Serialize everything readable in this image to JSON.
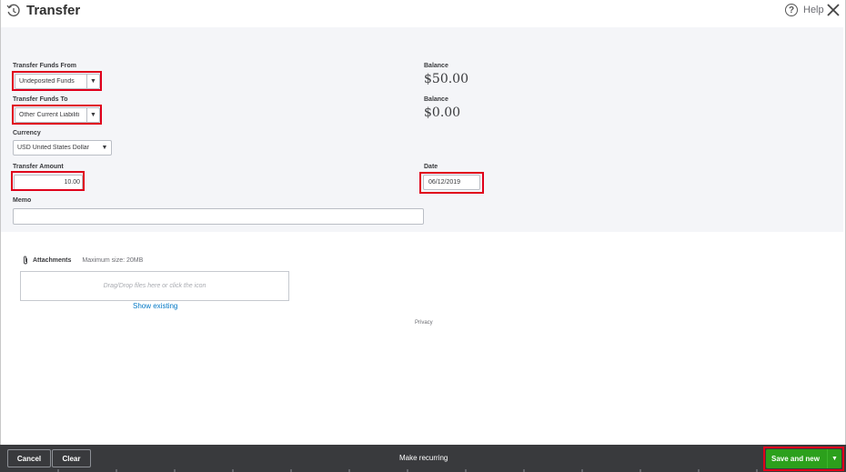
{
  "header": {
    "title": "Transfer",
    "help_label": "Help",
    "icons": {
      "title": "transfer-clock-icon",
      "help": "help-circle-icon",
      "close": "close-icon"
    }
  },
  "form": {
    "from": {
      "label": "Transfer Funds From",
      "value": "Undeposited Funds",
      "balance_label": "Balance",
      "balance": "$50.00"
    },
    "to": {
      "label": "Transfer Funds To",
      "value": "Other Current Liabiliti",
      "balance_label": "Balance",
      "balance": "$0.00"
    },
    "currency": {
      "label": "Currency",
      "value": "USD United States Dollar"
    },
    "amount": {
      "label": "Transfer Amount",
      "value": "10.00"
    },
    "date": {
      "label": "Date",
      "value": "06/12/2019"
    },
    "memo": {
      "label": "Memo",
      "value": ""
    }
  },
  "attachments": {
    "label": "Attachments",
    "max_size": "Maximum size: 20MB",
    "dropzone_text": "Drag/Drop files here or click the icon",
    "show_existing": "Show existing"
  },
  "privacy": "Privacy",
  "footer": {
    "cancel": "Cancel",
    "clear": "Clear",
    "make_recurring": "Make recurring",
    "save_and_new": "Save and new"
  },
  "colors": {
    "highlight": "#e0001b",
    "save_green": "#2ca01c",
    "footer_bg": "#393a3d",
    "link_blue": "#0077c5"
  }
}
